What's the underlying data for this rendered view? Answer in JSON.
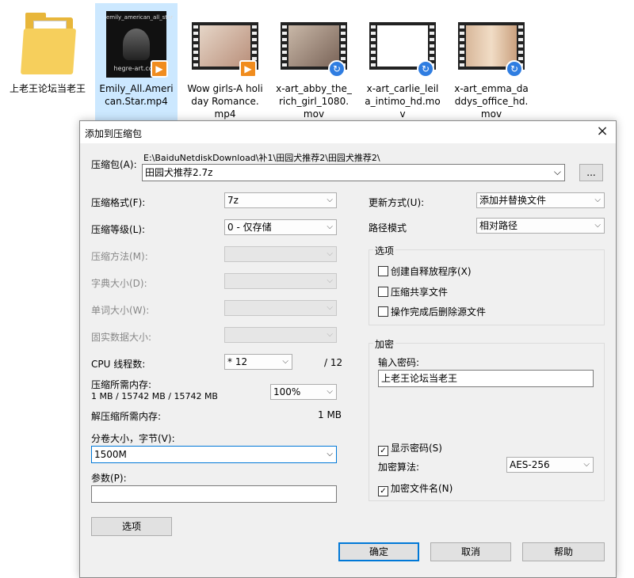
{
  "files": [
    {
      "name": "上老王论坛当老王",
      "type": "folder",
      "selected": false
    },
    {
      "name": "Emily_All.American.Star.mp4",
      "type": "video",
      "selected": true,
      "thumb_text": [
        "emily_american_all_star",
        "hegre-art.com"
      ]
    },
    {
      "name": "Wow girls-A holiday Romance.mp4",
      "type": "video",
      "selected": false
    },
    {
      "name": "x-art_abby_the_rich_girl_1080.mov",
      "type": "video",
      "selected": false
    },
    {
      "name": "x-art_carlie_leila_intimo_hd.mov",
      "type": "video",
      "selected": false
    },
    {
      "name": "x-art_emma_daddys_office_hd.mov",
      "type": "video",
      "selected": false
    }
  ],
  "dialog": {
    "title": "添加到压缩包",
    "close_icon": "×",
    "archive_label": "压缩包(A):",
    "archive_path": "E:\\BaiduNetdiskDownload\\补1\\田园犬推荐2\\田园犬推荐2\\",
    "archive_name": "田园犬推荐2.7z",
    "browse_label": "...",
    "format_label": "压缩格式(F):",
    "format_value": "7z",
    "level_label": "压缩等级(L):",
    "level_value": "0 - 仅存储",
    "method_label": "压缩方法(M):",
    "dict_label": "字典大小(D):",
    "word_label": "单词大小(W):",
    "solid_label": "固实数据大小:",
    "cpu_label": "CPU 线程数:",
    "cpu_value": "* 12",
    "cpu_total": "/ 12",
    "mem_comp_label": "压缩所需内存:",
    "mem_comp_value": "1 MB / 15742 MB / 15742 MB",
    "mem_percent": "100%",
    "mem_decomp_label": "解压缩所需内存:",
    "mem_decomp_value": "1 MB",
    "split_label": "分卷大小，字节(V):",
    "split_value": "1500M",
    "params_label": "参数(P):",
    "params_value": "",
    "options_button": "选项",
    "update_label": "更新方式(U):",
    "update_value": "添加并替换文件",
    "path_label": "路径模式",
    "path_value": "相对路径",
    "options_group": "选项",
    "opt_sfx": "创建自释放程序(X)",
    "opt_shared": "压缩共享文件",
    "opt_delete": "操作完成后删除源文件",
    "encrypt_group": "加密",
    "password_label": "输入密码:",
    "password_value": "上老王论坛当老王",
    "show_password": "显示密码(S)",
    "enc_method_label": "加密算法:",
    "enc_method_value": "AES-256",
    "encrypt_names": "加密文件名(N)",
    "ok_button": "确定",
    "cancel_button": "取消",
    "help_button": "帮助"
  }
}
